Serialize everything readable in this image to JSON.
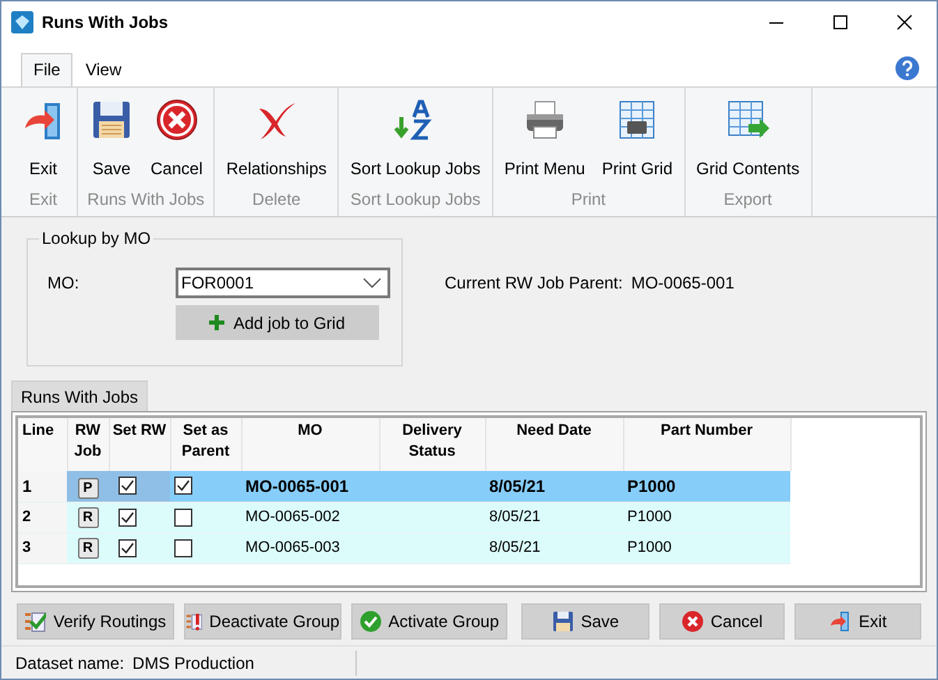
{
  "window": {
    "title": "Runs With Jobs"
  },
  "ribbon_tabs": [
    {
      "label": "File",
      "selected": true
    },
    {
      "label": "View",
      "selected": false
    }
  ],
  "ribbon_groups": [
    {
      "label": "Exit",
      "buttons": [
        {
          "label": "Exit",
          "kind": "exit"
        }
      ]
    },
    {
      "label": "Runs With Jobs",
      "buttons": [
        {
          "label": "Save",
          "kind": "save"
        },
        {
          "label": "Cancel",
          "kind": "cancel"
        }
      ]
    },
    {
      "label": "Delete",
      "buttons": [
        {
          "label": "Relationships",
          "kind": "delete"
        }
      ]
    },
    {
      "label": "Sort Lookup Jobs",
      "buttons": [
        {
          "label": "Sort Lookup Jobs",
          "kind": "sort"
        }
      ]
    },
    {
      "label": "Print",
      "buttons": [
        {
          "label": "Print Menu",
          "kind": "printer"
        },
        {
          "label": "Print Grid",
          "kind": "printgrid"
        }
      ]
    },
    {
      "label": "Export",
      "buttons": [
        {
          "label": "Grid Contents",
          "kind": "export"
        }
      ]
    }
  ],
  "lookup": {
    "title": "Lookup by MO",
    "mo_label": "MO:",
    "mo_value": "FOR0001",
    "add_button": "Add job to Grid"
  },
  "current_parent": {
    "label": "Current RW Job Parent:",
    "value": "MO-0065-001"
  },
  "grid_tab": {
    "label": "Runs With Jobs",
    "selected": true
  },
  "table": {
    "columns": [
      "Line",
      "RW Job",
      "Set RW",
      "Set as Parent",
      "MO",
      "Delivery Status",
      "Need Date",
      "Part Number"
    ],
    "rows": [
      {
        "line": "1",
        "rw_job": "P",
        "set_rw": true,
        "set_as_parent": true,
        "mo": "MO-0065-001",
        "need_date": "8/05/21",
        "part_number": "P1000",
        "selected": true
      },
      {
        "line": "2",
        "rw_job": "R",
        "set_rw": true,
        "set_as_parent": false,
        "mo": "MO-0065-002",
        "need_date": "8/05/21",
        "part_number": "P1000",
        "selected": false
      },
      {
        "line": "3",
        "rw_job": "R",
        "set_rw": true,
        "set_as_parent": false,
        "mo": "MO-0065-003",
        "need_date": "8/05/21",
        "part_number": "P1000",
        "selected": false
      }
    ]
  },
  "buttons": [
    {
      "label": "Verify Routings",
      "kind": "verify"
    },
    {
      "label": "Deactivate Group",
      "kind": "deactivate"
    },
    {
      "label": "Activate Group",
      "kind": "activate"
    },
    {
      "label": "Save",
      "kind": "save"
    },
    {
      "label": "Cancel",
      "kind": "cancel"
    },
    {
      "label": "Exit",
      "kind": "exit"
    }
  ],
  "status_bar": {
    "label": "Dataset name:",
    "value": "DMS Production"
  }
}
